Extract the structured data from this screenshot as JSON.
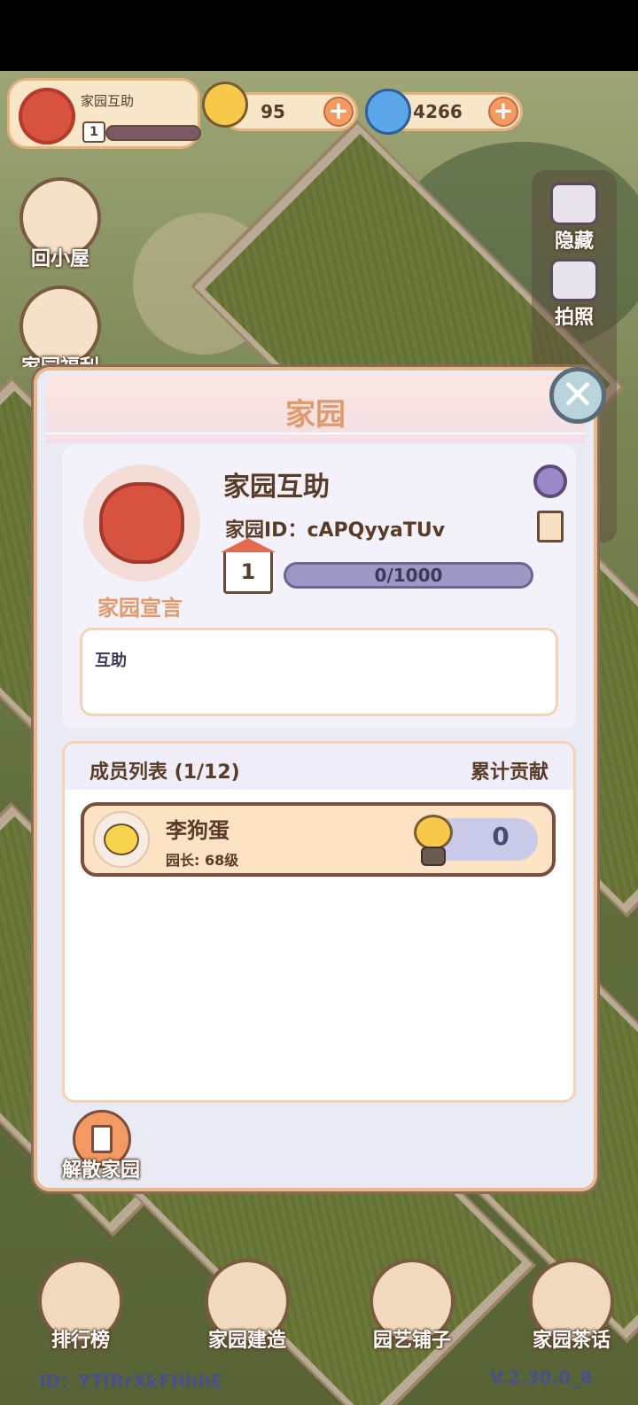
{
  "hud": {
    "garden_name": "家园互助",
    "garden_level": "1",
    "snail_count": "95",
    "swirl_count": "4266",
    "plus_symbol": "+"
  },
  "left_buttons": [
    {
      "label": "回小屋",
      "icon": "house-icon"
    },
    {
      "label": "家园福利",
      "icon": "gift-icon"
    }
  ],
  "right_buttons": [
    {
      "label": "隐藏",
      "icon": "hide-icon"
    },
    {
      "label": "拍照",
      "icon": "camera-icon"
    }
  ],
  "modal": {
    "title": "家园",
    "close_symbol": "✕",
    "info": {
      "name": "家园互助",
      "id_text": "家园ID：cAPQyyaTUv",
      "level": "1",
      "progress_text": "0/1000",
      "progress_fraction": 0,
      "manifesto_label": "家园宣言",
      "manifesto_text": "互助"
    },
    "members": {
      "header_title": "成员列表 (1/12)",
      "header_contribution": "累计贡献",
      "rows": [
        {
          "name": "李狗蛋",
          "role": "园长: 68级",
          "contribution": "0"
        }
      ]
    },
    "disband_label": "解散家园"
  },
  "bottom_nav": [
    {
      "label": "排行榜",
      "icon": "leaderboard-icon"
    },
    {
      "label": "家园建造",
      "icon": "build-icon"
    },
    {
      "label": "园艺铺子",
      "icon": "gardening-shop-icon"
    },
    {
      "label": "家园茶话",
      "icon": "chat-icon"
    }
  ],
  "footer": {
    "player_id": "ID：YTfRrXkFHhhE",
    "version": "V.2.30.0_8"
  },
  "colors": {
    "accent_orange": "#e09a6c",
    "text_brown": "#5a3b27",
    "progress_purple": "#9b98c4"
  }
}
